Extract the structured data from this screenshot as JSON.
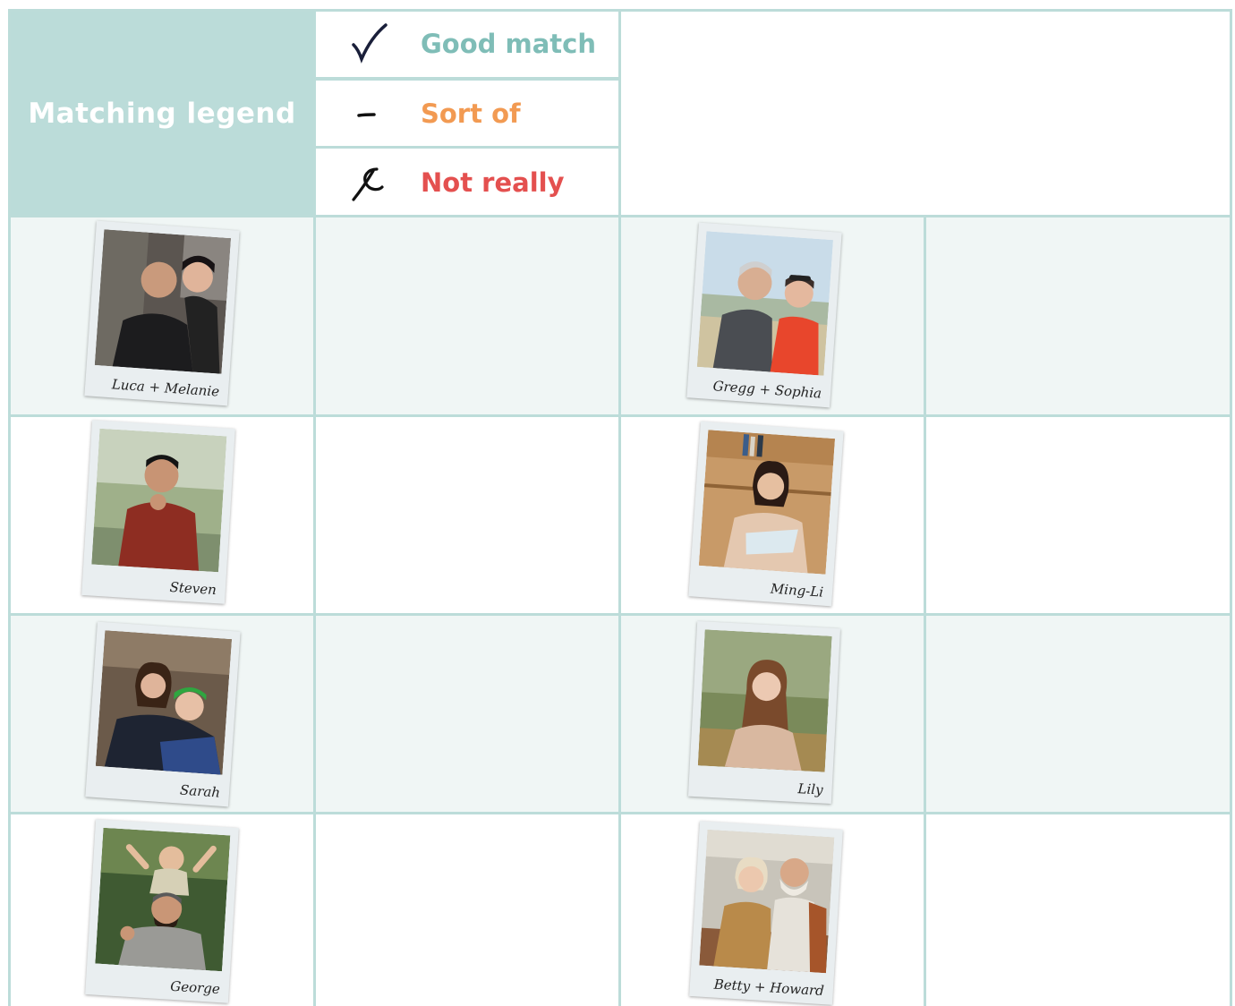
{
  "legend": {
    "title": "Matching legend",
    "items": [
      {
        "label": "Good match",
        "color": "#7fbdb7",
        "icon": "check-mark-icon"
      },
      {
        "label": "Sort of",
        "color": "#f29a52",
        "icon": "dash-mark-icon"
      },
      {
        "label": "Not really",
        "color": "#e4504f",
        "icon": "cross-mark-icon"
      }
    ]
  },
  "colors": {
    "header_bg": "#bbdcd9",
    "border": "#bcdcd9",
    "row_shade": "#f0f6f5"
  },
  "people": [
    {
      "caption": "Luca + Melanie"
    },
    {
      "caption": "Gregg + Sophia"
    },
    {
      "caption": "Steven"
    },
    {
      "caption": "Ming-Li"
    },
    {
      "caption": "Sarah"
    },
    {
      "caption": "Lily"
    },
    {
      "caption": "George"
    },
    {
      "caption": "Betty + Howard"
    }
  ]
}
